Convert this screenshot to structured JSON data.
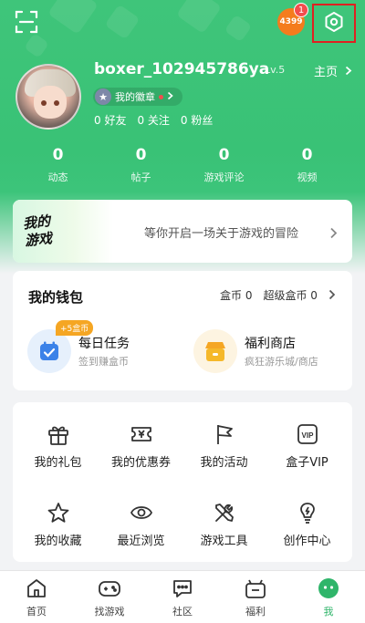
{
  "header": {
    "coin_badge": "4399",
    "notification_count": "1"
  },
  "profile": {
    "username": "boxer_102945786ya",
    "level": "Lv.5",
    "home_link": "主页",
    "badge_label": "我的徽章",
    "friends": "0 好友",
    "following": "0 关注",
    "fans": "0 粉丝"
  },
  "stats": [
    {
      "value": "0",
      "label": "动态"
    },
    {
      "value": "0",
      "label": "帖子"
    },
    {
      "value": "0",
      "label": "游戏评论"
    },
    {
      "value": "0",
      "label": "视频"
    }
  ],
  "banner": {
    "logo_text": "我的游戏",
    "text": "等你开启一场关于游戏的冒险"
  },
  "wallet": {
    "title": "我的钱包",
    "box_coin": "盒币 0",
    "super_box_coin": "超级盒币 0",
    "daily_task": {
      "name": "每日任务",
      "sub": "签到赚盒币",
      "tag": "+5盒币"
    },
    "welfare_shop": {
      "name": "福利商店",
      "sub": "疯狂游乐城/商店"
    }
  },
  "grid": [
    {
      "label": "我的礼包",
      "icon": "gift-icon"
    },
    {
      "label": "我的优惠券",
      "icon": "coupon-icon"
    },
    {
      "label": "我的活动",
      "icon": "flag-icon"
    },
    {
      "label": "盒子VIP",
      "icon": "vip-icon"
    },
    {
      "label": "我的收藏",
      "icon": "star-icon"
    },
    {
      "label": "最近浏览",
      "icon": "eye-icon"
    },
    {
      "label": "游戏工具",
      "icon": "tools-icon"
    },
    {
      "label": "创作中心",
      "icon": "lightbulb-icon"
    }
  ],
  "nav": [
    {
      "label": "首页",
      "icon": "home-icon"
    },
    {
      "label": "找游戏",
      "icon": "gamepad-icon"
    },
    {
      "label": "社区",
      "icon": "chat-icon"
    },
    {
      "label": "福利",
      "icon": "gift-box-icon"
    },
    {
      "label": "我",
      "icon": "me-icon",
      "active": true
    }
  ],
  "colors": {
    "brand_green": "#3cc47a",
    "alert_red": "#e02020",
    "accent_orange": "#f5a623"
  }
}
